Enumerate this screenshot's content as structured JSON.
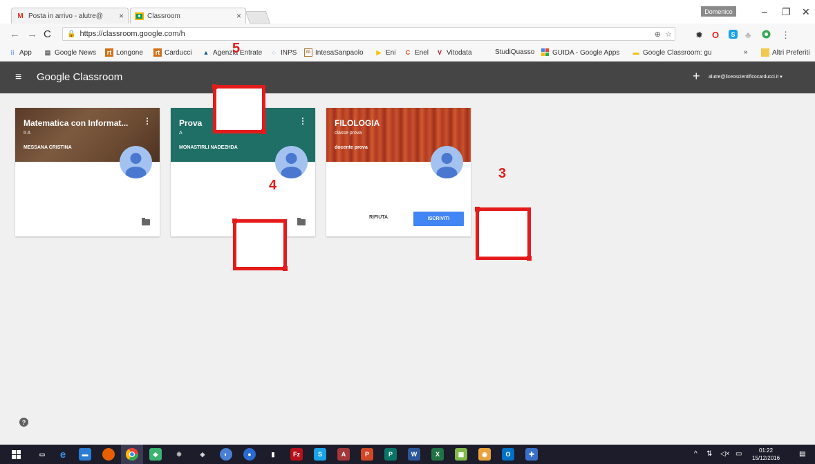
{
  "browser": {
    "tabs": [
      {
        "label": "Posta in arrivo - alutre@",
        "icon": "gmail-icon"
      },
      {
        "label": "Classroom",
        "icon": "classroom-icon"
      }
    ],
    "user_badge": "Domenico",
    "url": "https://classroom.google.com/h",
    "bookmarks": [
      {
        "label": "App",
        "icon": "apps-grid-icon",
        "color": "#4285f4"
      },
      {
        "label": "Google News",
        "icon": "news-icon",
        "color": "#555555"
      },
      {
        "label": "Longone",
        "icon": "rt-icon",
        "color": "#d0711b"
      },
      {
        "label": "Carducci",
        "icon": "rt-icon",
        "color": "#d0711b"
      },
      {
        "label": "Agenzia Entrate",
        "icon": "agenzia-icon",
        "color": "#1a5e9a"
      },
      {
        "label": "INPS",
        "icon": "inps-icon",
        "color": "#2a6fb5"
      },
      {
        "label": "IntesaSanpaolo",
        "icon": "intesa-icon",
        "color": "#b87333"
      },
      {
        "label": "Eni",
        "icon": "eni-icon",
        "color": "#f2c200"
      },
      {
        "label": "Enel",
        "icon": "enel-icon",
        "color": "#e04a1f"
      },
      {
        "label": "Vitodata",
        "icon": "v-icon",
        "color": "#c0162c"
      },
      {
        "label": "StudiQuasso",
        "icon": "",
        "color": "#888888"
      },
      {
        "label": "GUIDA - Google Apps",
        "icon": "google-apps-icon",
        "color": "#4285f4"
      },
      {
        "label": "Google Classroom: gu",
        "icon": "classroom-icon",
        "color": "#f0c000"
      },
      {
        "label": "»",
        "icon": "",
        "color": "#333333"
      },
      {
        "label": "Altri Preferiti",
        "icon": "folder-icon",
        "color": "#f2c94c"
      }
    ]
  },
  "app": {
    "title": "Google Classroom",
    "account": "alutre@liceoscientificocarducci.it",
    "help": "?"
  },
  "cards": [
    {
      "title": "Matematica con Informat...",
      "section": "II A",
      "teacher": "MESSANA CRISTINA"
    },
    {
      "title": "Prova",
      "section": "A",
      "teacher": "MONASTIRLI NADEZHDA"
    },
    {
      "title": "FILOLOGIA",
      "section": "classe prova",
      "teacher": "docente prova",
      "reject_label": "RIFIUTA",
      "join_label": "ISCRIVITI"
    }
  ],
  "annotations": {
    "n3": "3",
    "n4": "4",
    "n5": "5"
  },
  "taskbar": {
    "time": "01:22",
    "date": "15/12/2016"
  },
  "colors": {
    "header": "#454545",
    "join_button": "#4285f4",
    "annotation": "#e51b1b",
    "card2_banner": "#1f6f66"
  }
}
